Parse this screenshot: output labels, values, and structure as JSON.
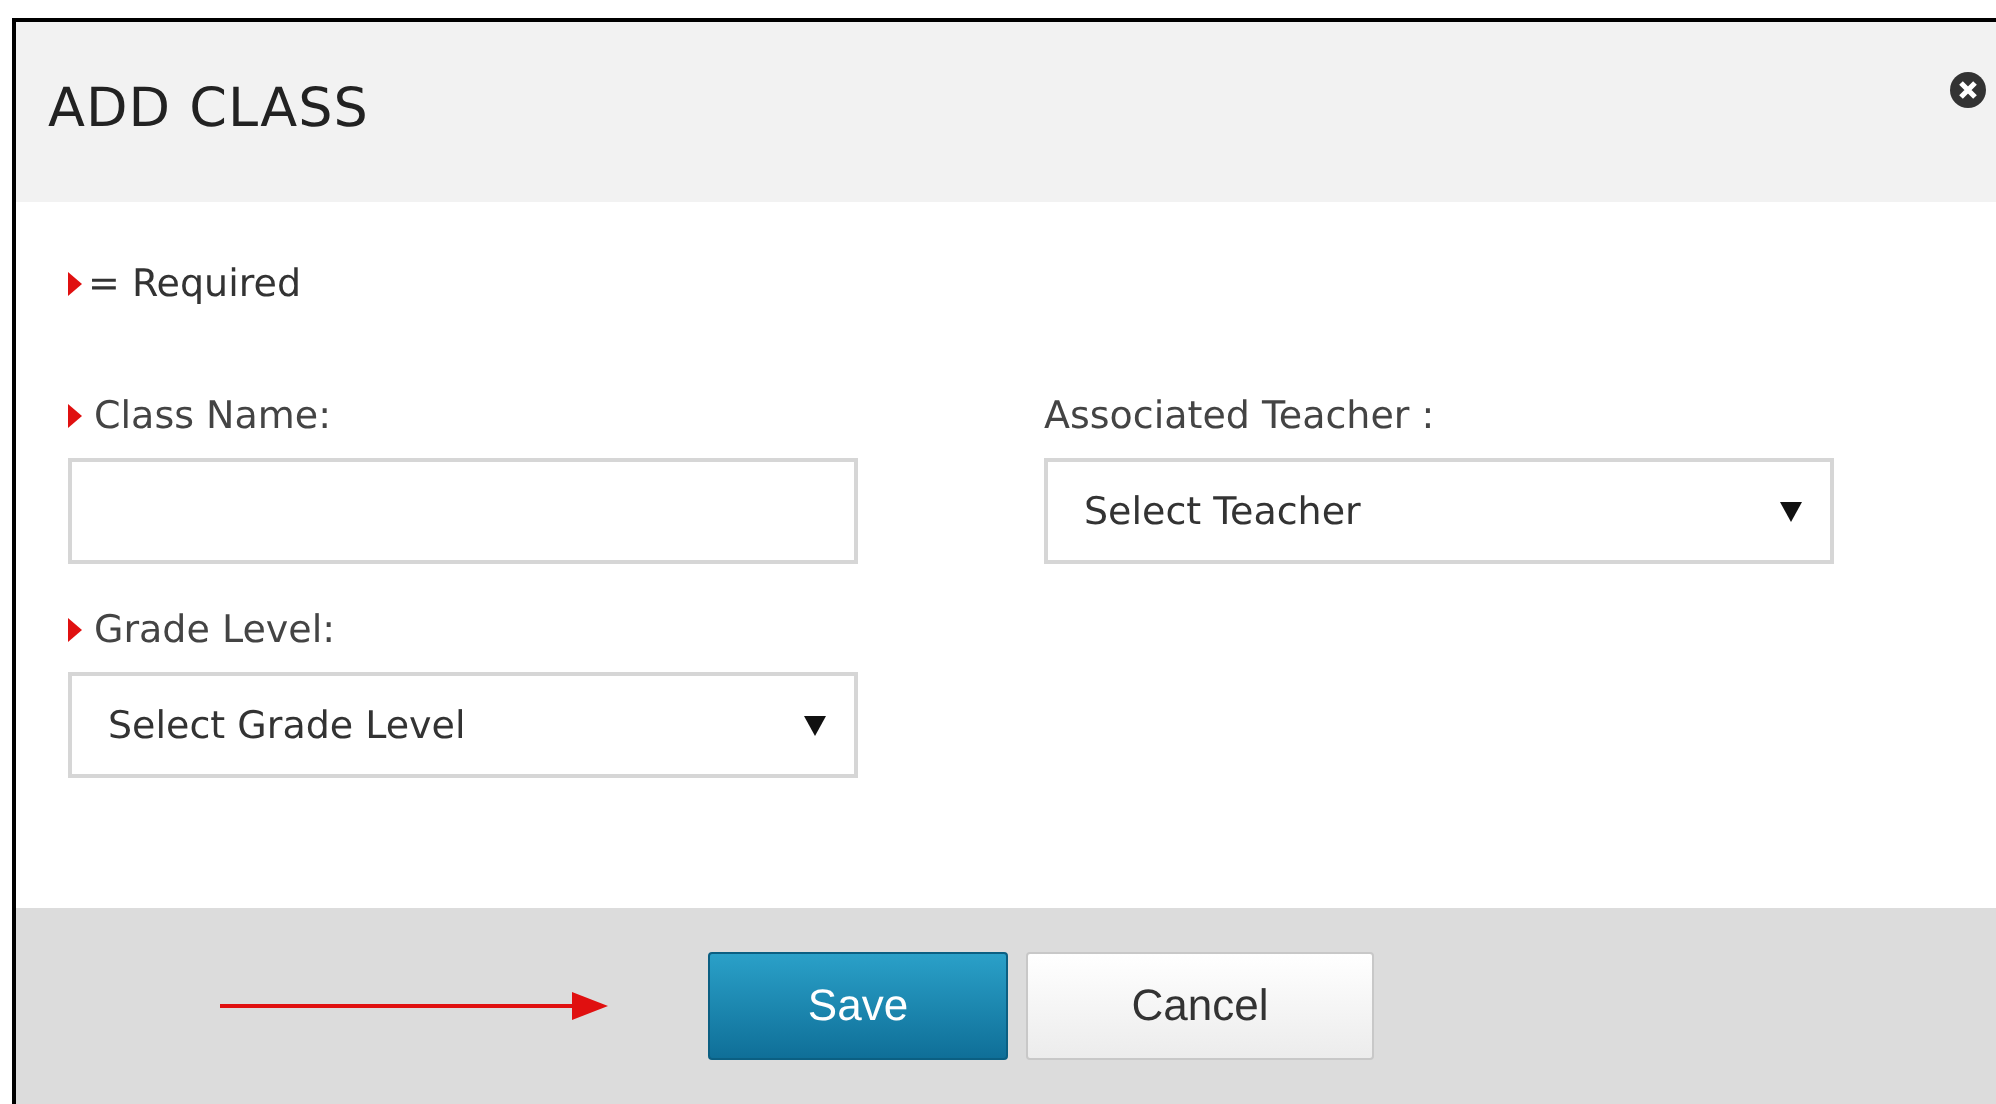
{
  "dialog": {
    "title": "ADD CLASS"
  },
  "legend": {
    "text": "= Required"
  },
  "fields": [
    {
      "label": "Class Name:",
      "required": true,
      "kind": "text"
    },
    {
      "label": "Associated Teacher :",
      "required": false,
      "kind": "select",
      "value": "Select Teacher"
    },
    {
      "label": "Grade Level:",
      "required": true,
      "kind": "select",
      "value": "Select Grade Level"
    }
  ],
  "buttons": [
    {
      "label": "Save",
      "kind": "primary"
    },
    {
      "label": "Cancel",
      "kind": "secondary"
    }
  ]
}
